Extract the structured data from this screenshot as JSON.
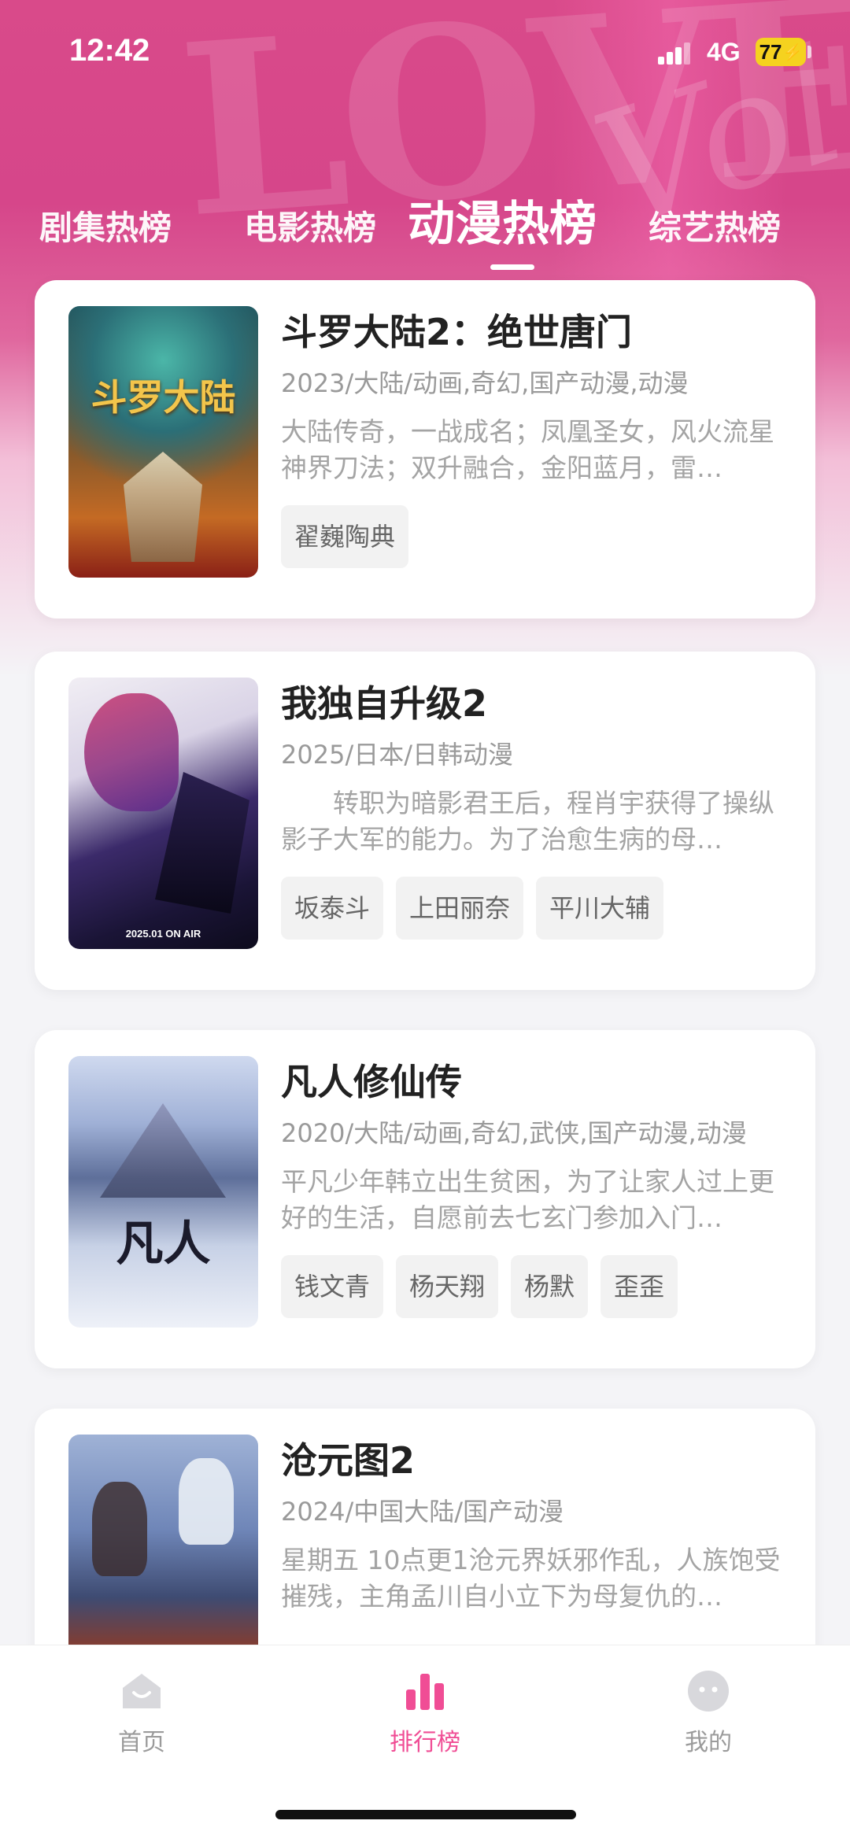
{
  "status_bar": {
    "time": "12:42",
    "network": "4G",
    "battery": "77"
  },
  "tabs": [
    {
      "label": "剧集热榜",
      "active": false
    },
    {
      "label": "电影热榜",
      "active": false
    },
    {
      "label": "动漫热榜",
      "active": true
    },
    {
      "label": "综艺热榜",
      "active": false
    }
  ],
  "items": [
    {
      "title": "斗罗大陆2：绝世唐门",
      "meta": "2023/大陆/动画,奇幻,国产动漫,动漫",
      "desc": "大陆传奇，一战成名；凤凰圣女，风火流星神界刀法；双升融合，金阳蓝月，雷…",
      "tags": [
        "翟巍陶典"
      ],
      "poster_text": "斗罗大陆"
    },
    {
      "title": "我独自升级2",
      "meta": "2025/日本/日韩动漫",
      "desc": "　　转职为暗影君王后，程肖宇获得了操纵影子大军的能力。为了治愈生病的母…",
      "tags": [
        "坂泰斗",
        "上田丽奈",
        "平川大辅"
      ],
      "poster_text": "2025.01 ON AIR"
    },
    {
      "title": "凡人修仙传",
      "meta": "2020/大陆/动画,奇幻,武侠,国产动漫,动漫",
      "desc": "平凡少年韩立出生贫困，为了让家人过上更好的生活，自愿前去七玄门参加入门…",
      "tags": [
        "钱文青",
        "杨天翔",
        "杨默",
        "歪歪"
      ],
      "poster_text": "凡人"
    },
    {
      "title": "沧元图2",
      "meta": "2024/中国大陆/国产动漫",
      "desc": "星期五 10点更1沧元界妖邪作乱，人族饱受摧残，主角孟川自小立下为母复仇的…",
      "tags": [],
      "poster_text": ""
    }
  ],
  "bottom_nav": [
    {
      "label": "首页",
      "icon": "home-icon",
      "active": false
    },
    {
      "label": "排行榜",
      "icon": "ranking-bars-icon",
      "active": true
    },
    {
      "label": "我的",
      "icon": "profile-face-icon",
      "active": false
    }
  ],
  "colors": {
    "accent": "#f04d95",
    "hero": "#d94a8a"
  }
}
